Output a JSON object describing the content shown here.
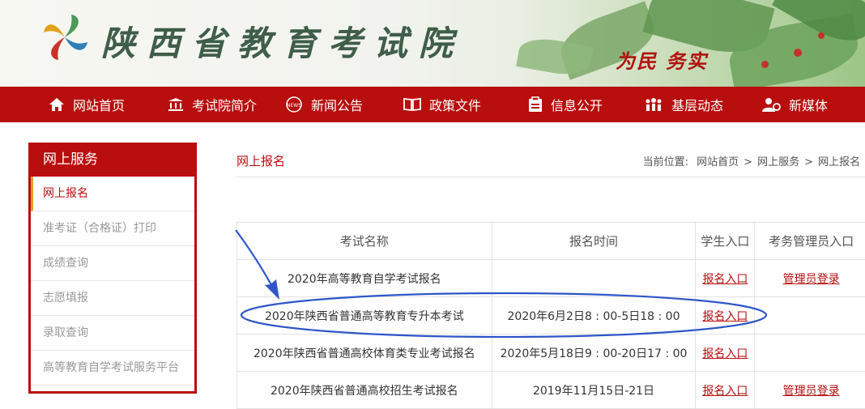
{
  "header": {
    "site_title": "陕西省教育考试院",
    "slogan_part1": "为民",
    "slogan_part2": "务实"
  },
  "nav": [
    {
      "label": "网站首页",
      "icon": "home-icon"
    },
    {
      "label": "考试院简介",
      "icon": "building-icon"
    },
    {
      "label": "新闻公告",
      "icon": "news-icon"
    },
    {
      "label": "政策文件",
      "icon": "book-icon"
    },
    {
      "label": "信息公开",
      "icon": "clipboard-icon"
    },
    {
      "label": "基层动态",
      "icon": "people-icon"
    },
    {
      "label": "新媒体",
      "icon": "media-icon"
    }
  ],
  "sidebar": {
    "heading": "网上服务",
    "items": [
      {
        "label": "网上报名"
      },
      {
        "label": "准考证（合格证）打印"
      },
      {
        "label": "成绩查询"
      },
      {
        "label": "志愿填报"
      },
      {
        "label": "录取查询"
      },
      {
        "label": "高等教育自学考试服务平台"
      }
    ]
  },
  "main": {
    "title": "网上报名",
    "breadcrumb": {
      "prefix": "当前位置:",
      "items": [
        "网站首页",
        "网上服务",
        "网上报名"
      ],
      "separator": ">"
    },
    "table": {
      "headers": [
        "考试名称",
        "报名时间",
        "学生入口",
        "考务管理员入口"
      ],
      "rows": [
        {
          "name": "2020年高等教育自学考试报名",
          "time": "",
          "student": "报名入口",
          "admin": "管理员登录"
        },
        {
          "name": "2020年陕西省普通高等教育专升本考试",
          "time": "2020年6月2日8 : 00-5日18 : 00",
          "student": "报名入口",
          "admin": ""
        },
        {
          "name": "2020年陕西省普通高校体育类专业考试报名",
          "time": "2020年5月18日9 : 00-20日17 : 00",
          "student": "报名入口",
          "admin": ""
        },
        {
          "name": "2020年陕西省普通高校招生考试报名",
          "time": "2019年11月15日-21日",
          "student": "报名入口",
          "admin": "管理员登录"
        }
      ]
    }
  },
  "colors": {
    "brand_red": "#b90e0e",
    "annotation_blue": "#2f55c9"
  }
}
